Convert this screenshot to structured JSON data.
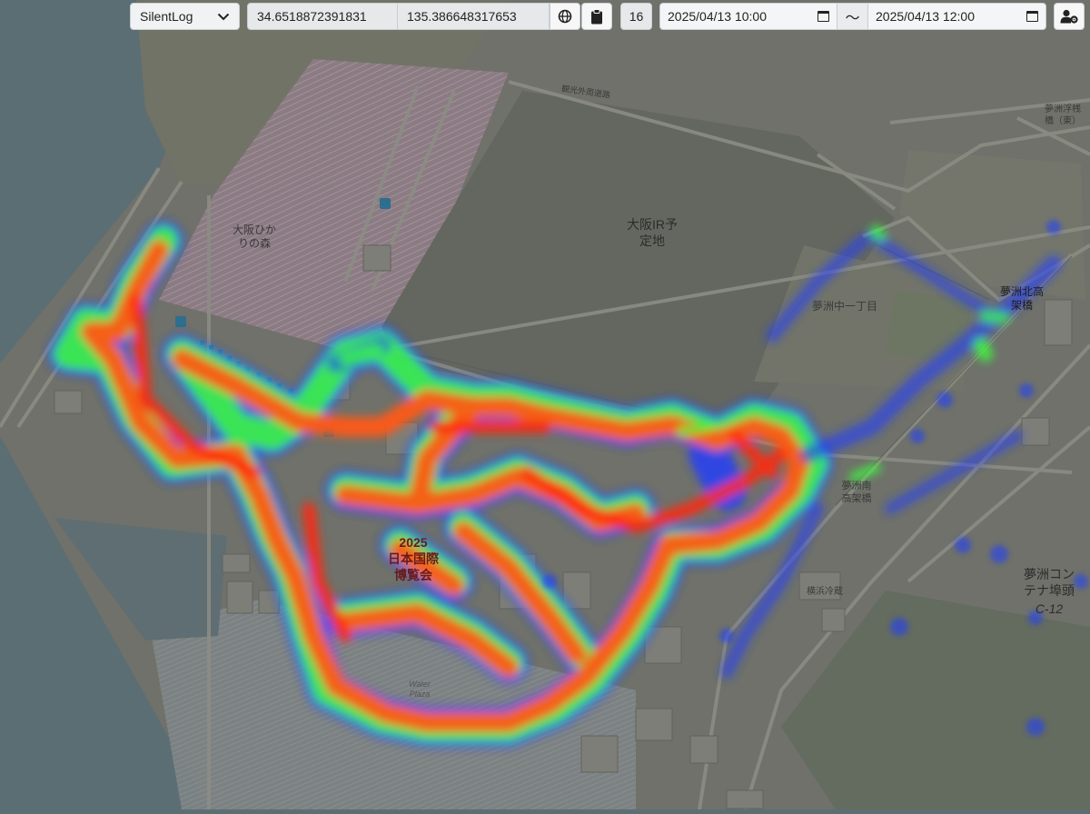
{
  "toolbar": {
    "source_select": "SilentLog",
    "latitude": "34.6518872391831",
    "longitude": "135.386648317653",
    "zoom": "16",
    "start_datetime": "2025/04/13 10:00",
    "range_separator": "〜",
    "end_datetime": "2025/04/13 12:00"
  },
  "icons": {
    "select_chevron": "chevron-down-icon",
    "globe": "globe-icon",
    "clipboard": "clipboard-icon",
    "calendar": "calendar-icon",
    "user_settings": "user-gear-icon"
  },
  "map_labels": {
    "osaka_hikari": "大阪ひか\nりの森",
    "osaka_ir": "大阪IR予\n定地",
    "kanko_road": "観光外周道路",
    "yumeshima_1chome": "夢洲中一丁目",
    "yumeshima_kita_bridge": "夢洲北高\n架橋",
    "yumeshima_pier_bridge": "夢洲浮桟\n橋（東）",
    "expo": "2025\n日本国際\n博覧会",
    "container_terminal": "夢洲コン\nテナ埠頭",
    "terminal_code": "C-12",
    "yokohama_reizo": "横浜冷蔵",
    "water_plaza": "Water\nPlaza",
    "yumeshima_minami_bridge": "夢洲南\n高架橋"
  },
  "colors": {
    "sea": "#5b6e73",
    "land": "#6f716a",
    "heat_low": "#1e3cff",
    "heat_mid": "#3cff3c",
    "heat_high": "#ff5a14"
  }
}
